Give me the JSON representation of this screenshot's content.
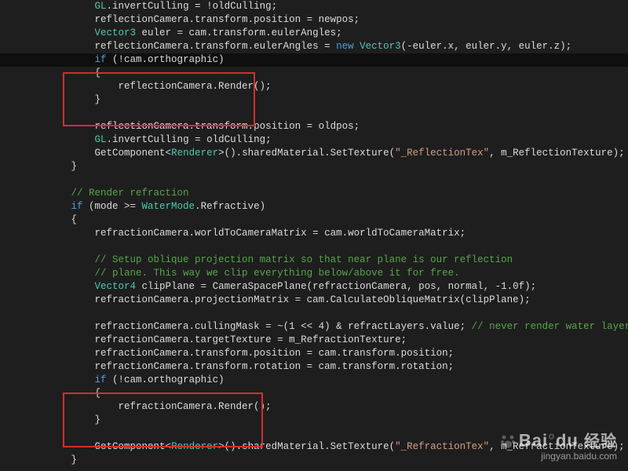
{
  "code": {
    "lines": [
      {
        "indent": 2,
        "tokens": [
          [
            "k-type",
            "GL"
          ],
          [
            "k-plain",
            ".invertCulling = !oldCulling;"
          ]
        ]
      },
      {
        "indent": 2,
        "tokens": [
          [
            "k-plain",
            "reflectionCamera.transform.position = newpos;"
          ]
        ]
      },
      {
        "indent": 2,
        "tokens": [
          [
            "k-type",
            "Vector3"
          ],
          [
            "k-plain",
            " euler = cam.transform.eulerAngles;"
          ]
        ]
      },
      {
        "indent": 2,
        "tokens": [
          [
            "k-plain",
            "reflectionCamera.transform.eulerAngles = "
          ],
          [
            "k-blue",
            "new"
          ],
          [
            "k-plain",
            " "
          ],
          [
            "k-type",
            "Vector3"
          ],
          [
            "k-plain",
            "(-euler.x, euler.y, euler.z);"
          ]
        ]
      },
      {
        "indent": 2,
        "hl": true,
        "tokens": [
          [
            "k-blue",
            "if"
          ],
          [
            "k-plain",
            " (!cam.orthographic)"
          ]
        ]
      },
      {
        "indent": 2,
        "tokens": [
          [
            "k-plain",
            "{"
          ]
        ]
      },
      {
        "indent": 3,
        "tokens": [
          [
            "k-plain",
            "reflectionCamera.Render();"
          ]
        ]
      },
      {
        "indent": 2,
        "tokens": [
          [
            "k-plain",
            "}"
          ]
        ]
      },
      {
        "indent": 0,
        "tokens": [
          [
            "k-plain",
            ""
          ]
        ]
      },
      {
        "indent": 2,
        "tokens": [
          [
            "k-plain",
            "reflectionCamera.transform.position = oldpos;"
          ]
        ]
      },
      {
        "indent": 2,
        "tokens": [
          [
            "k-type",
            "GL"
          ],
          [
            "k-plain",
            ".invertCulling = oldCulling;"
          ]
        ]
      },
      {
        "indent": 2,
        "tokens": [
          [
            "k-plain",
            "GetComponent<"
          ],
          [
            "k-type",
            "Renderer"
          ],
          [
            "k-plain",
            ">().sharedMaterial.SetTexture("
          ],
          [
            "k-string",
            "\"_ReflectionTex\""
          ],
          [
            "k-plain",
            ", m_ReflectionTexture);"
          ]
        ]
      },
      {
        "indent": 1,
        "tokens": [
          [
            "k-plain",
            "}"
          ]
        ]
      },
      {
        "indent": 0,
        "tokens": [
          [
            "k-plain",
            ""
          ]
        ]
      },
      {
        "indent": 1,
        "tokens": [
          [
            "k-comment",
            "// Render refraction"
          ]
        ]
      },
      {
        "indent": 1,
        "tokens": [
          [
            "k-blue",
            "if"
          ],
          [
            "k-plain",
            " (mode >= "
          ],
          [
            "k-type",
            "WaterMode"
          ],
          [
            "k-plain",
            ".Refractive)"
          ]
        ]
      },
      {
        "indent": 1,
        "tokens": [
          [
            "k-plain",
            "{"
          ]
        ]
      },
      {
        "indent": 2,
        "tokens": [
          [
            "k-plain",
            "refractionCamera.worldToCameraMatrix = cam.worldToCameraMatrix;"
          ]
        ]
      },
      {
        "indent": 0,
        "tokens": [
          [
            "k-plain",
            ""
          ]
        ]
      },
      {
        "indent": 2,
        "tokens": [
          [
            "k-comment",
            "// Setup oblique projection matrix so that near plane is our reflection"
          ]
        ]
      },
      {
        "indent": 2,
        "tokens": [
          [
            "k-comment",
            "// plane. This way we clip everything below/above it for free."
          ]
        ]
      },
      {
        "indent": 2,
        "tokens": [
          [
            "k-type",
            "Vector4"
          ],
          [
            "k-plain",
            " clipPlane = CameraSpacePlane(refractionCamera, pos, normal, -1.0f);"
          ]
        ]
      },
      {
        "indent": 2,
        "tokens": [
          [
            "k-plain",
            "refractionCamera.projectionMatrix = cam.CalculateObliqueMatrix(clipPlane);"
          ]
        ]
      },
      {
        "indent": 0,
        "tokens": [
          [
            "k-plain",
            ""
          ]
        ]
      },
      {
        "indent": 2,
        "tokens": [
          [
            "k-plain",
            "refractionCamera.cullingMask = ~(1 << 4) & refractLayers.value; "
          ],
          [
            "k-comment",
            "// never render water layer"
          ]
        ]
      },
      {
        "indent": 2,
        "tokens": [
          [
            "k-plain",
            "refractionCamera.targetTexture = m_RefractionTexture;"
          ]
        ]
      },
      {
        "indent": 2,
        "tokens": [
          [
            "k-plain",
            "refractionCamera.transform.position = cam.transform.position;"
          ]
        ]
      },
      {
        "indent": 2,
        "tokens": [
          [
            "k-plain",
            "refractionCamera.transform.rotation = cam.transform.rotation;"
          ]
        ]
      },
      {
        "indent": 2,
        "tokens": [
          [
            "k-blue",
            "if"
          ],
          [
            "k-plain",
            " (!cam.orthographic)"
          ]
        ]
      },
      {
        "indent": 2,
        "tokens": [
          [
            "k-plain",
            "{"
          ]
        ]
      },
      {
        "indent": 3,
        "tokens": [
          [
            "k-plain",
            "refractionCamera.Render();"
          ]
        ]
      },
      {
        "indent": 2,
        "tokens": [
          [
            "k-plain",
            "}"
          ]
        ]
      },
      {
        "indent": 0,
        "tokens": [
          [
            "k-plain",
            ""
          ]
        ]
      },
      {
        "indent": 2,
        "tokens": [
          [
            "k-plain",
            "GetComponent<"
          ],
          [
            "k-type",
            "Renderer"
          ],
          [
            "k-plain",
            ">().sharedMaterial.SetTexture("
          ],
          [
            "k-string",
            "\"_RefractionTex\""
          ],
          [
            "k-plain",
            ", m_RefractionTexture);"
          ]
        ]
      },
      {
        "indent": 1,
        "tokens": [
          [
            "k-plain",
            "}"
          ]
        ]
      }
    ]
  },
  "watermark": {
    "brand_left": "Bai",
    "brand_right": "du",
    "brand_cn": "经验",
    "url": "jingyan.baidu.com"
  }
}
